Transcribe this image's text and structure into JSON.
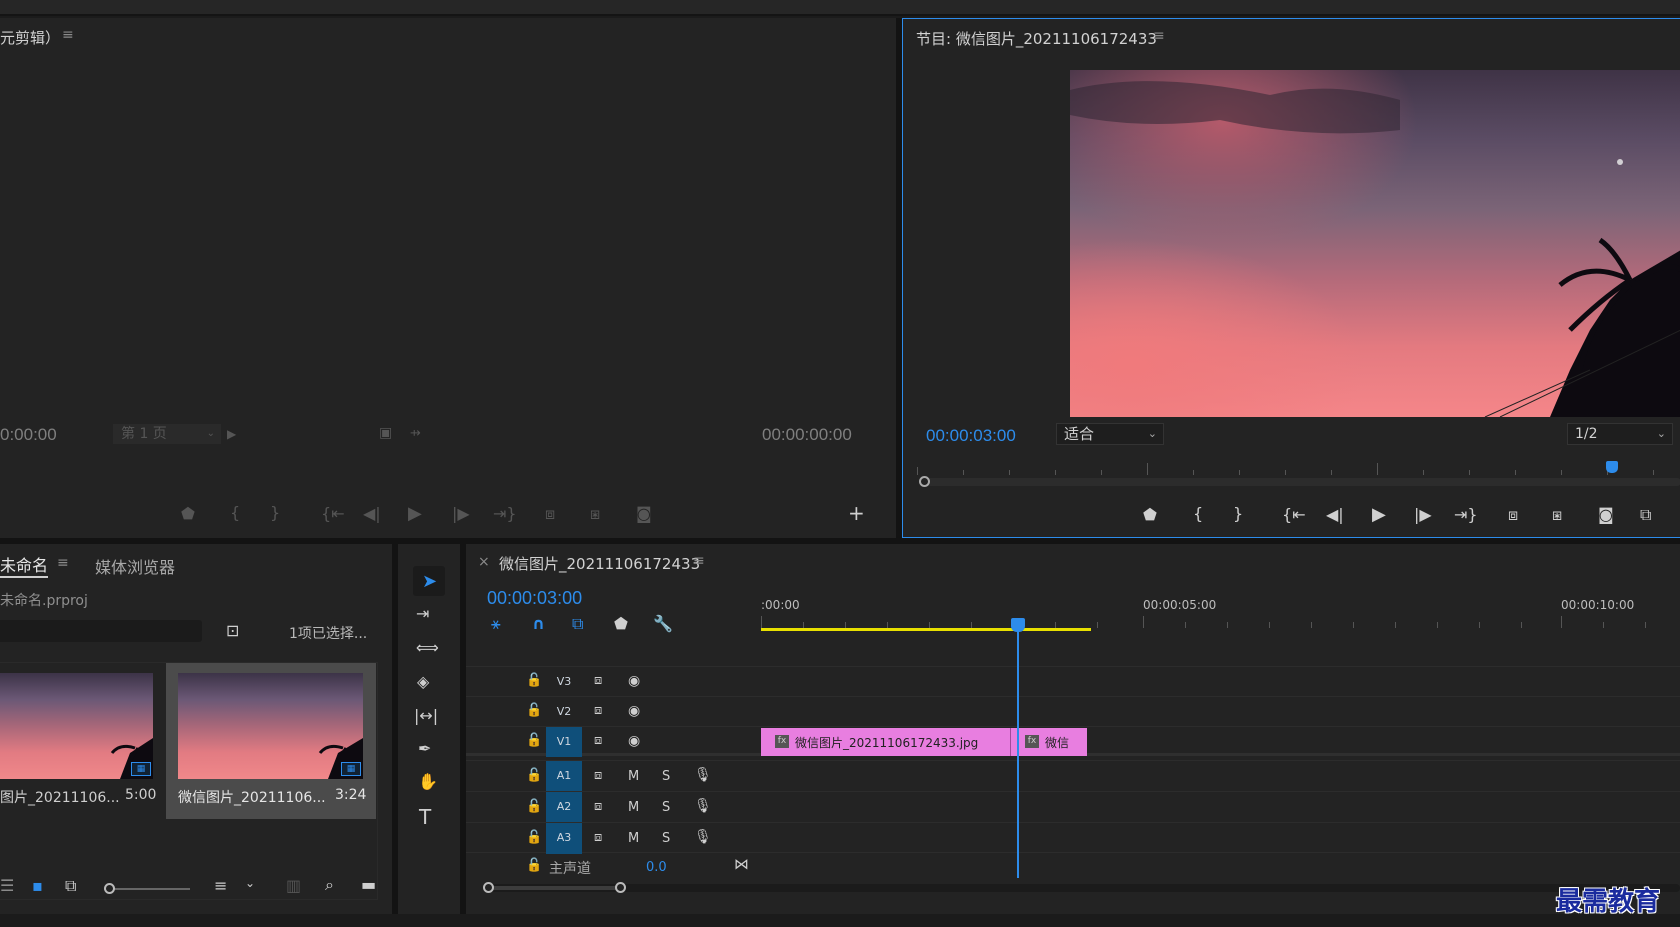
{
  "source_panel": {
    "title": "元剪辑）",
    "timecode_left": "0:00:00",
    "page_select": "第 1 页",
    "timecode_right": "00:00:00:00"
  },
  "program_panel": {
    "title": "节目: 微信图片_20211106172433",
    "timecode": "00:00:03:00",
    "fit_select": "适合",
    "resolution_select": "1/2"
  },
  "project_panel": {
    "tab_project": "未命名",
    "tab_media_browser": "媒体浏览器",
    "project_file": "未命名.prproj",
    "selection_status": "1项已选择...",
    "items": [
      {
        "name": "图片_20211106...",
        "duration": "5:00"
      },
      {
        "name": "微信图片_20211106...",
        "duration": "3:24"
      }
    ]
  },
  "timeline_panel": {
    "close_glyph": "×",
    "sequence_name": "微信图片_20211106172433",
    "timecode": "00:00:03:00",
    "ruler_labels": [
      ":00:00",
      "00:00:05:00",
      "00:00:10:00"
    ],
    "tracks_video": [
      "V3",
      "V2",
      "V1"
    ],
    "tracks_audio": [
      "A1",
      "A2",
      "A3"
    ],
    "mute_label": "M",
    "solo_label": "S",
    "master_label": "主声道",
    "master_value": "0.0",
    "clip_main": "微信图片_20211106172433.jpg",
    "clip_second": "微信",
    "fx_label": "fx"
  },
  "watermark": "最需教育",
  "colors": {
    "accent": "#2d8ceb",
    "clip": "#e87ee0",
    "work_area": "#e8e000",
    "track_header": "#0f4f7a"
  }
}
